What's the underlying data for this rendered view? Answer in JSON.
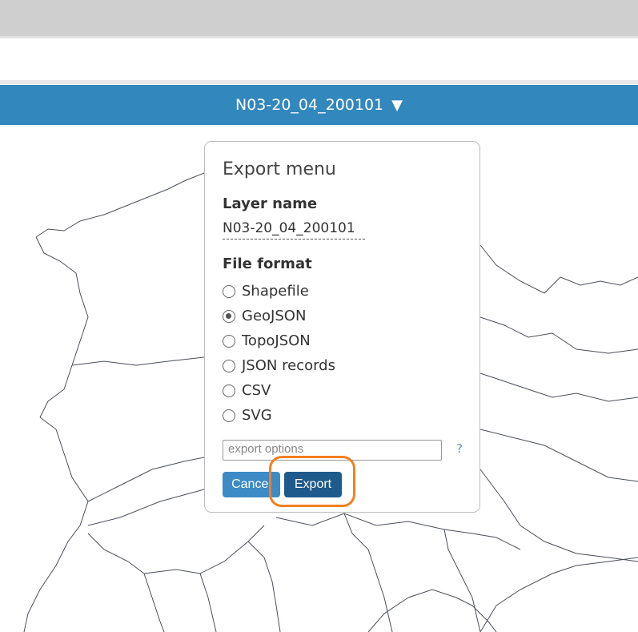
{
  "layer_selector": {
    "name": "N03-20_04_200101",
    "caret": "▼"
  },
  "dialog": {
    "title": "Export menu",
    "layer_name_label": "Layer name",
    "layer_name_value": "N03-20_04_200101",
    "file_format_label": "File format",
    "formats": [
      {
        "label": "Shapefile",
        "checked": false
      },
      {
        "label": "GeoJSON",
        "checked": true
      },
      {
        "label": "TopoJSON",
        "checked": false
      },
      {
        "label": "JSON records",
        "checked": false
      },
      {
        "label": "CSV",
        "checked": false
      },
      {
        "label": "SVG",
        "checked": false
      }
    ],
    "options_placeholder": "export options",
    "help": "?",
    "cancel_label": "Cancel",
    "export_label": "Export"
  },
  "colors": {
    "layer_bar": "#3287bd",
    "export_button": "#1f5a8c",
    "highlight": "#f28020"
  }
}
